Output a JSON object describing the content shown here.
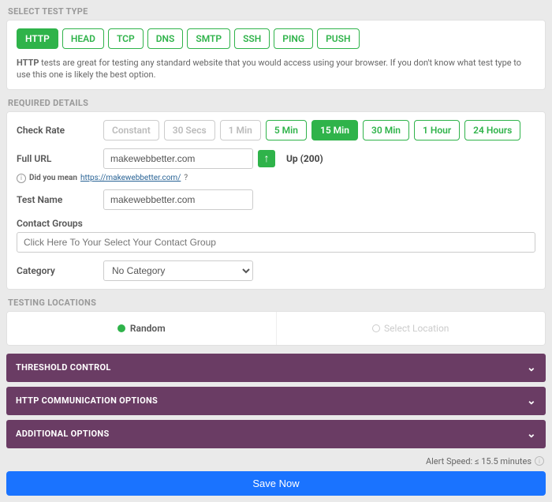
{
  "sections": {
    "testType": "SELECT TEST TYPE",
    "required": "REQUIRED DETAILS",
    "locations": "TESTING LOCATIONS"
  },
  "testTypes": {
    "items": [
      "HTTP",
      "HEAD",
      "TCP",
      "DNS",
      "SMTP",
      "SSH",
      "PING",
      "PUSH"
    ],
    "selected": "HTTP",
    "description": "HTTP tests are great for testing any standard website that you would access using your browser. If you don't know what test type to use this one is likely the best option."
  },
  "labels": {
    "checkRate": "Check Rate",
    "fullUrl": "Full URL",
    "testName": "Test Name",
    "contactGroups": "Contact Groups",
    "category": "Category"
  },
  "checkRates": {
    "items": [
      {
        "label": "Constant",
        "state": "disabled"
      },
      {
        "label": "30 Secs",
        "state": "disabled"
      },
      {
        "label": "1 Min",
        "state": "disabled"
      },
      {
        "label": "5 Min",
        "state": "enabled"
      },
      {
        "label": "15 Min",
        "state": "selected"
      },
      {
        "label": "30 Min",
        "state": "enabled"
      },
      {
        "label": "1 Hour",
        "state": "enabled"
      },
      {
        "label": "24 Hours",
        "state": "enabled"
      }
    ]
  },
  "url": {
    "value": "makewebbetter.com",
    "status": "Up (200)",
    "suggestionPrefix": "Did you mean ",
    "suggestionLink": "https://makewebbetter.com/",
    "suggestionSuffix": "?"
  },
  "testName": {
    "value": "makewebbetter.com"
  },
  "contactGroups": {
    "placeholder": "Click Here To Your Select Your Contact Group"
  },
  "category": {
    "selected": "No Category"
  },
  "locations": {
    "random": "Random",
    "select": "Select Location"
  },
  "accordions": {
    "threshold": "THRESHOLD CONTROL",
    "http": "HTTP COMMUNICATION OPTIONS",
    "additional": "ADDITIONAL OPTIONS"
  },
  "footer": {
    "alertSpeed": "Alert Speed: ≤ 15.5 minutes",
    "save": "Save Now"
  }
}
